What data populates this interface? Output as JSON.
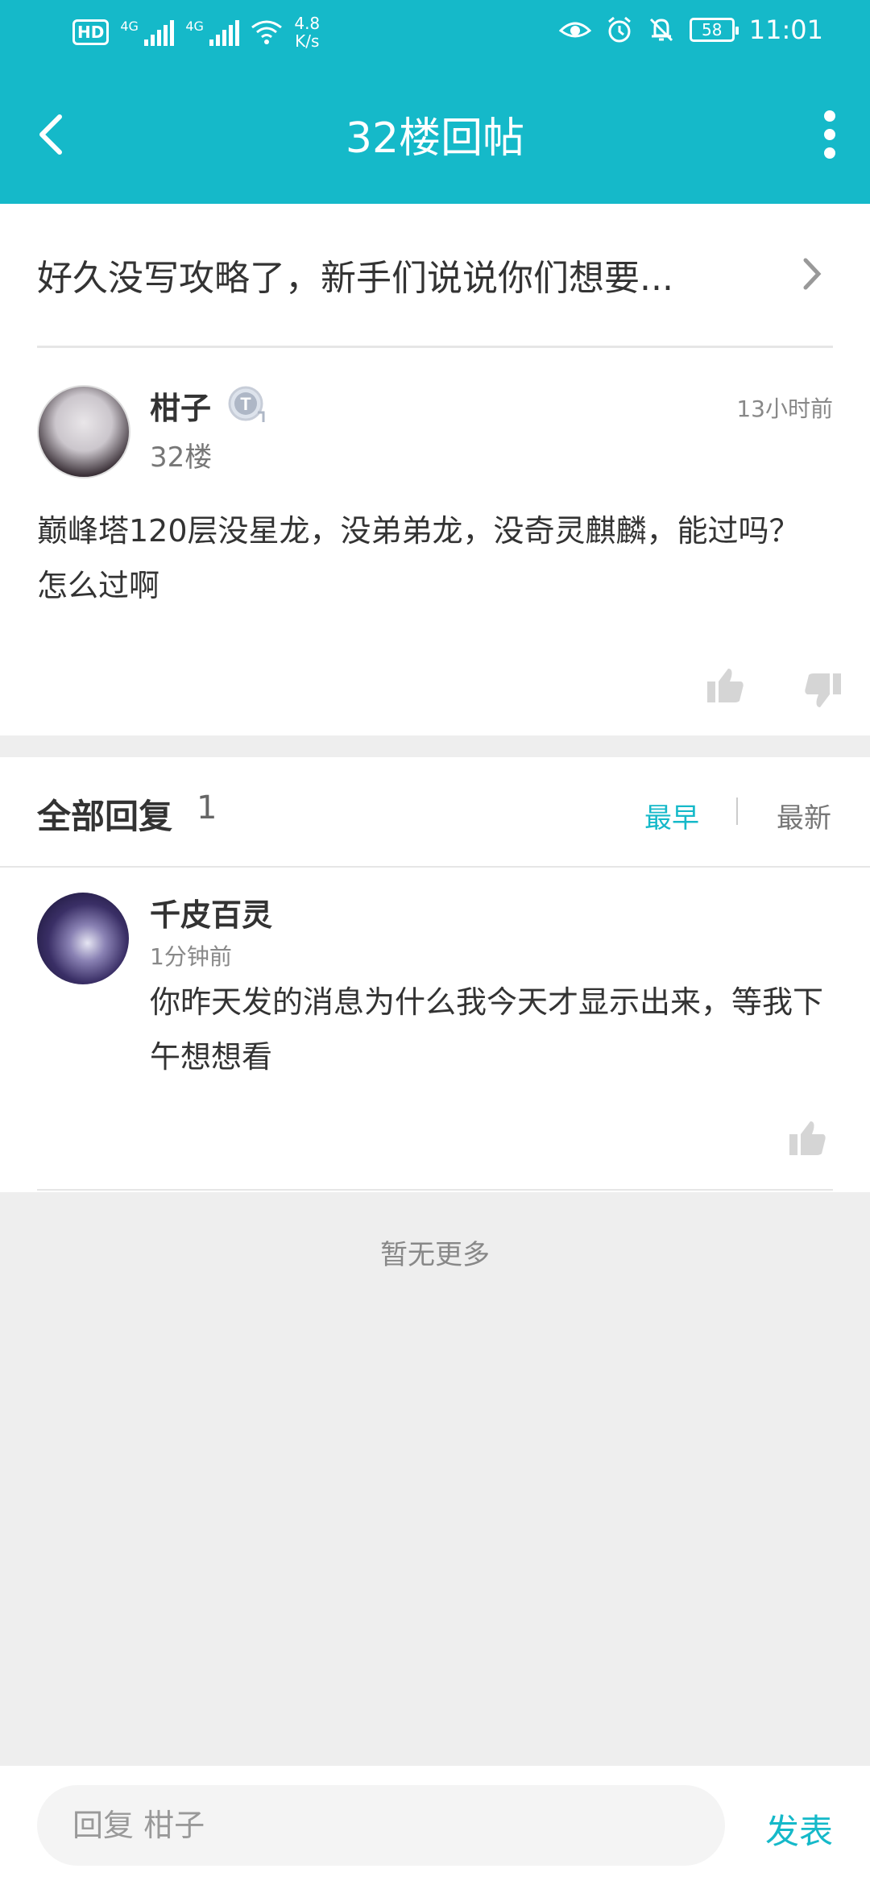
{
  "status_bar": {
    "hd": "HD",
    "sim1_tag": "4G",
    "sim2_tag": "4G",
    "net_speed_value": "4.8",
    "net_speed_unit": "K/s",
    "battery": "58",
    "time": "11:01"
  },
  "header": {
    "title": "32楼回帖"
  },
  "thread": {
    "link_text": "好久没写攻略了，新手们说说你们想要..."
  },
  "post": {
    "author": "柑子",
    "level_badge": "T",
    "floor": "32楼",
    "time": "13小时前",
    "content": "巅峰塔120层没星龙，没弟弟龙，没奇灵麒麟，能过吗？怎么过啊"
  },
  "replies": {
    "header_label": "全部回复",
    "count": "1",
    "sort_earliest": "最早",
    "sort_newest": "最新",
    "items": [
      {
        "author": "千皮百灵",
        "time": "1分钟前",
        "content": "你昨天发的消息为什么我今天才显示出来，等我下午想想看"
      }
    ],
    "no_more": "暂无更多"
  },
  "bottom_bar": {
    "placeholder": "回复 柑子",
    "send_label": "发表"
  },
  "colors": {
    "accent": "#15b9c9"
  }
}
